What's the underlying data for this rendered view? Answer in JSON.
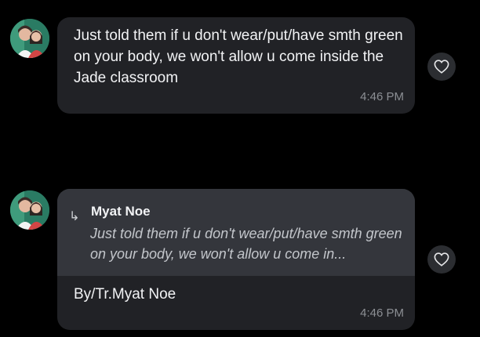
{
  "messages": [
    {
      "text": "Just told them if u don't wear/put/have smth green on your body, we won't allow u come inside the Jade classroom",
      "time": "4:46 PM",
      "avatar_icon": "profile-photo-icon",
      "react_icon": "heart-icon"
    },
    {
      "reply_to": {
        "author": "Myat Noe",
        "quote": "Just told them if u don't wear/put/have smth green on your body, we won't allow u come in...",
        "arrow_icon": "reply-arrow-icon"
      },
      "text": "By/Tr.Myat Noe",
      "time": "4:46 PM",
      "avatar_icon": "profile-photo-icon",
      "react_icon": "heart-icon"
    }
  ],
  "colors": {
    "background": "#000000",
    "bubble": "#212226",
    "reply_block": "#34363c",
    "timestamp": "#8c8f94",
    "reaction_button": "#2b2d31"
  }
}
